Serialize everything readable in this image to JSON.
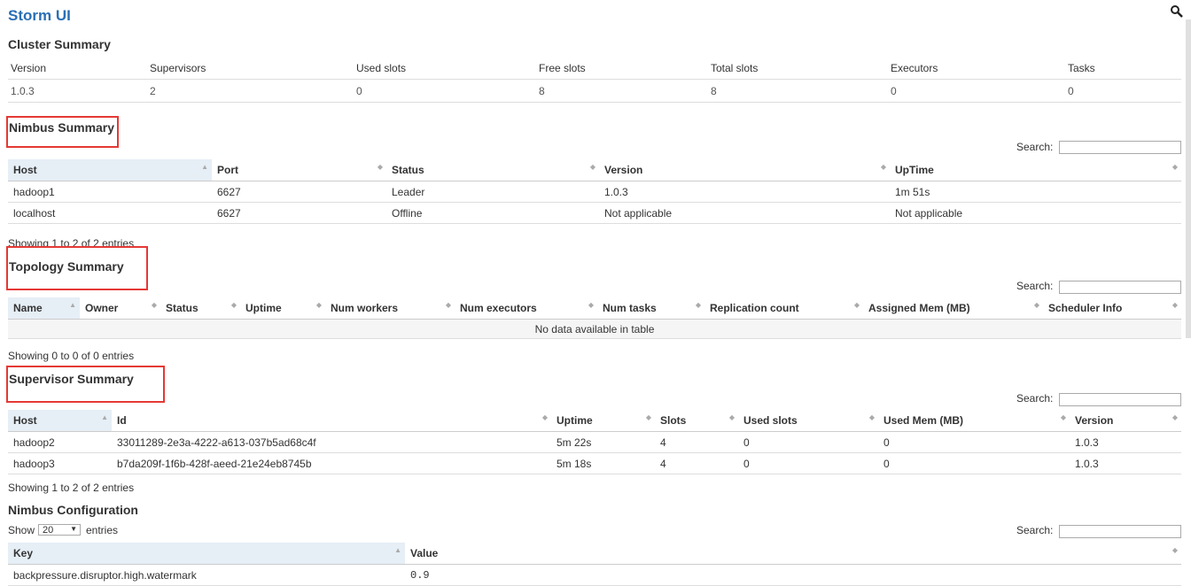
{
  "app": {
    "title": "Storm UI",
    "search_icon": "search-icon"
  },
  "cluster_summary": {
    "title": "Cluster Summary",
    "headers": [
      "Version",
      "Supervisors",
      "Used slots",
      "Free slots",
      "Total slots",
      "Executors",
      "Tasks"
    ],
    "values": [
      "1.0.3",
      "2",
      "0",
      "8",
      "8",
      "0",
      "0"
    ]
  },
  "nimbus_summary": {
    "title": "Nimbus Summary",
    "search_label": "Search:",
    "headers": [
      "Host",
      "Port",
      "Status",
      "Version",
      "UpTime"
    ],
    "rows": [
      [
        "hadoop1",
        "6627",
        "Leader",
        "1.0.3",
        "1m 51s"
      ],
      [
        "localhost",
        "6627",
        "Offline",
        "Not applicable",
        "Not applicable"
      ]
    ],
    "info": "Showing 1 to 2 of 2 entries"
  },
  "topology_summary": {
    "title": "Topology Summary",
    "search_label": "Search:",
    "headers": [
      "Name",
      "Owner",
      "Status",
      "Uptime",
      "Num workers",
      "Num executors",
      "Num tasks",
      "Replication count",
      "Assigned Mem (MB)",
      "Scheduler Info"
    ],
    "empty": "No data available in table",
    "info": "Showing 0 to 0 of 0 entries"
  },
  "supervisor_summary": {
    "title": "Supervisor Summary",
    "search_label": "Search:",
    "headers": [
      "Host",
      "Id",
      "Uptime",
      "Slots",
      "Used slots",
      "Used Mem (MB)",
      "Version"
    ],
    "rows": [
      [
        "hadoop2",
        "33011289-2e3a-4222-a613-037b5ad68c4f",
        "5m 22s",
        "4",
        "0",
        "0",
        "1.0.3"
      ],
      [
        "hadoop3",
        "b7da209f-1f6b-428f-aeed-21e24eb8745b",
        "5m 18s",
        "4",
        "0",
        "0",
        "1.0.3"
      ]
    ],
    "info": "Showing 1 to 2 of 2 entries"
  },
  "nimbus_configuration": {
    "title": "Nimbus Configuration",
    "show_label": "Show",
    "show_value": "20",
    "entries_label": "entries",
    "search_label": "Search:",
    "headers": [
      "Key",
      "Value"
    ],
    "rows": [
      [
        "backpressure.disruptor.high.watermark",
        "0.9"
      ]
    ]
  },
  "colors": {
    "accent": "#2a6eb5",
    "highlight": "#e53935",
    "sorted_header": "#e6eef6"
  }
}
